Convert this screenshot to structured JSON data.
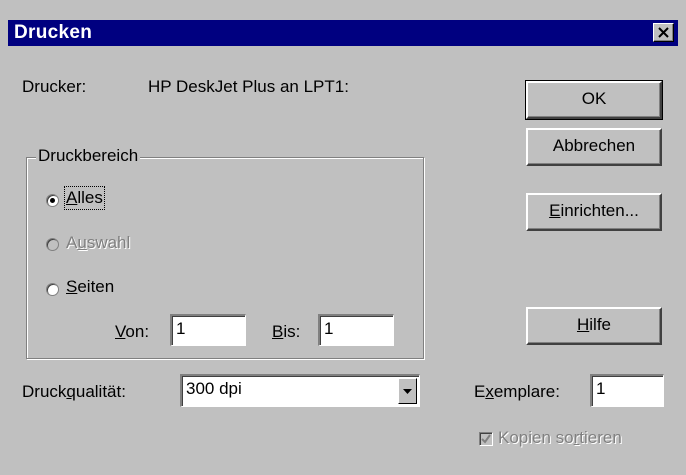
{
  "window": {
    "title": "Drucken"
  },
  "printer": {
    "label": "Drucker:",
    "name": "HP DeskJet Plus an LPT1:"
  },
  "buttons": {
    "ok": "OK",
    "cancel": "Abbrechen",
    "setup": "Einrichten...",
    "help": "Hilfe"
  },
  "range": {
    "legend": "Druckbereich",
    "all": "Alles",
    "selection": "Auswahl",
    "pages": "Seiten",
    "from_label": "Von:",
    "from_value": "1",
    "to_label": "Bis:",
    "to_value": "1",
    "selected": "all"
  },
  "quality": {
    "label": "Druckqualität:",
    "value": "300 dpi"
  },
  "copies": {
    "label": "Exemplare:",
    "value": "1",
    "collate_label": "Kopien sortieren",
    "collate_checked": true
  }
}
